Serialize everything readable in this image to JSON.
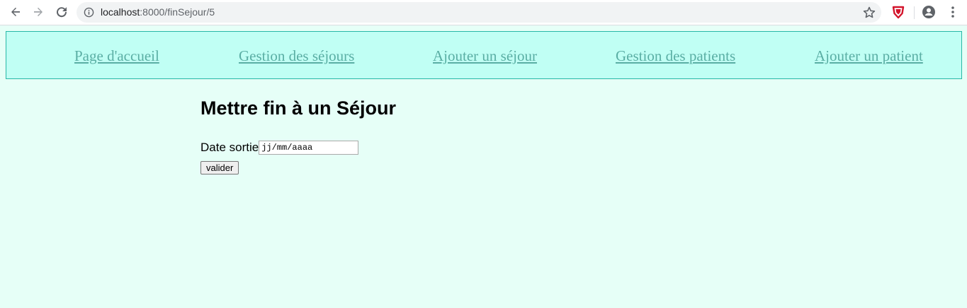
{
  "browser": {
    "url_host": "localhost",
    "url_path": ":8000/finSejour/5",
    "icons": {
      "back": "arrow-left-icon",
      "forward": "arrow-right-icon",
      "reload": "reload-icon",
      "info": "info-icon",
      "bookmark": "star-icon",
      "extension": "shield-icon",
      "profile": "profile-icon",
      "menu": "kebab-menu-icon"
    }
  },
  "nav": {
    "items": [
      {
        "label": "Page d'accueil"
      },
      {
        "label": "Gestion des séjours"
      },
      {
        "label": "Ajouter un séjour"
      },
      {
        "label": "Gestion des patients"
      },
      {
        "label": "Ajouter un patient"
      }
    ]
  },
  "main": {
    "title": "Mettre fin à un Séjour",
    "date_label": "Date sortie",
    "date_placeholder": "jj/mm/aaaa",
    "submit_label": "valider"
  },
  "colors": {
    "page_bg": "#e6fff7",
    "nav_bg": "#c0fff4",
    "nav_border": "#27b8a6",
    "link": "#5aaea4",
    "extension_red": "#d3142b"
  }
}
